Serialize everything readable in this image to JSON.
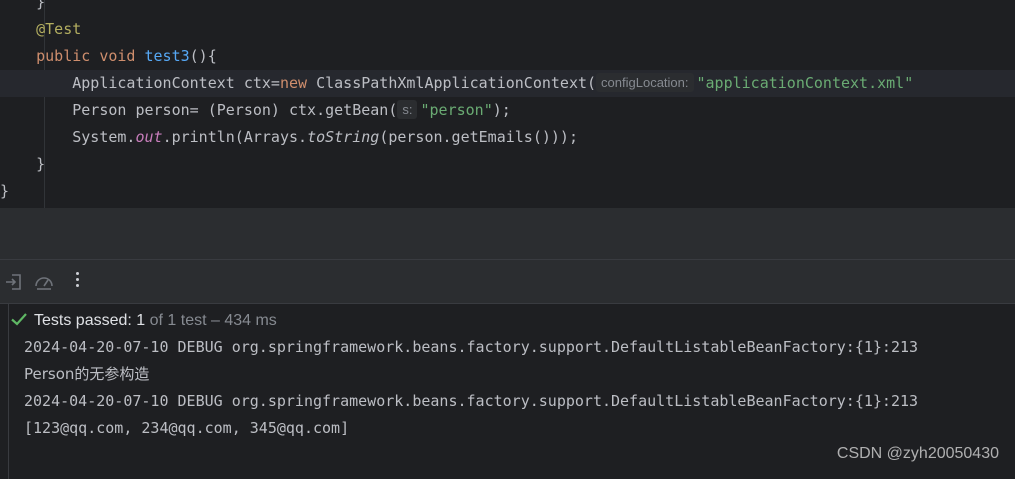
{
  "editor": {
    "brace_top": "}",
    "annotation": "@Test",
    "kw_public": "public",
    "kw_void": "void",
    "method_name": "test3",
    "method_tail": "(){",
    "line1_prefix": "ApplicationContext ctx=",
    "kw_new": "new",
    "line1_class": " ClassPathXmlApplicationContext(",
    "line1_hint": "configLocation:",
    "line1_string": "\"applicationContext.xml\"",
    "line2_prefix": "Person person= (Person) ctx.getBean(",
    "line2_hint": "s:",
    "line2_string": "\"person\"",
    "line2_tail": ");",
    "line3_a": "System.",
    "line3_field": "out",
    "line3_b": ".println(Arrays.",
    "line3_static": "toString",
    "line3_c": "(person.getEmails()));",
    "method_close": "}",
    "class_close": "}"
  },
  "toolbar": {
    "icons": [
      "import-test-results-icon",
      "test-history-icon",
      "more-options-icon"
    ]
  },
  "test_status": {
    "passed_label": "Tests passed: 1",
    "detail": " of 1 test – 434 ms"
  },
  "console": {
    "lines": [
      "2024-04-20-07-10 DEBUG org.springframework.beans.factory.support.DefaultListableBeanFactory:{1}:213",
      "Person的无参构造",
      "2024-04-20-07-10 DEBUG org.springframework.beans.factory.support.DefaultListableBeanFactory:{1}:213",
      "[123@qq.com, 234@qq.com, 345@qq.com]"
    ]
  },
  "watermark": "CSDN @zyh20050430",
  "colors": {
    "background": "#1e1f22",
    "keyword": "#cf8e6d",
    "annotation": "#b3ae60",
    "method": "#56a8f5",
    "string": "#6aab73",
    "field": "#c77dbb",
    "success": "#5fb865"
  }
}
